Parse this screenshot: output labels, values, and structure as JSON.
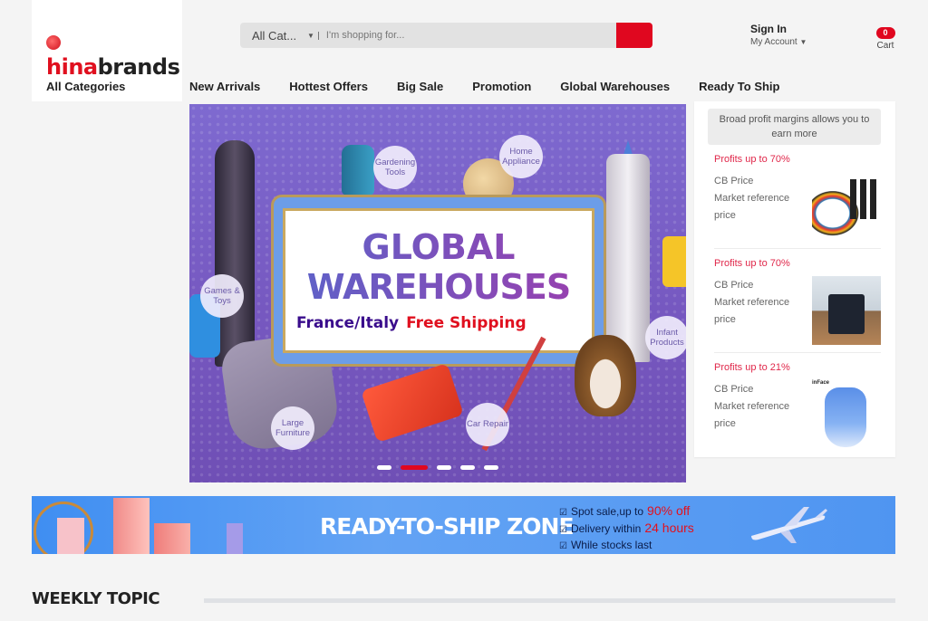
{
  "header": {
    "logo": {
      "part1": "hina",
      "part2": "brands",
      "lead": "c"
    },
    "search": {
      "category": "All Cat...",
      "placeholder": "I'm shopping for...",
      "value": ""
    },
    "account": {
      "sign_in": "Sign In",
      "my_account": "My Account"
    },
    "cart": {
      "count": "0",
      "label": "Cart"
    }
  },
  "nav": {
    "all_categories": "All Categories",
    "items": [
      "New Arrivals",
      "Hottest Offers",
      "Big Sale",
      "Promotion",
      "Global Warehouses",
      "Ready To Ship"
    ]
  },
  "hero": {
    "title_line1": "GLOBAL",
    "title_line2": "WAREHOUSES",
    "subtitle_left": "France/Italy",
    "subtitle_right": "Free Shipping",
    "bubbles": [
      "Gardening Tools",
      "Home Appliance",
      "Games & Toys",
      "Infant Products",
      "Large Furniture",
      "Car Repair"
    ],
    "slides_total": 5,
    "active_slide": 2
  },
  "profit_panel": {
    "note": "Broad profit margins allows you to earn more",
    "items": [
      {
        "profit": "Profits up to 70%",
        "cb_price": "CB Price",
        "market_ref_1": "Market reference",
        "market_ref_2": "price",
        "image": "resistance-bands"
      },
      {
        "profit": "Profits up to 70%",
        "cb_price": "CB Price",
        "market_ref_1": "Market reference",
        "market_ref_2": "price",
        "image": "uv-sterilizer"
      },
      {
        "profit": "Profits up to 21%",
        "cb_price": "CB Price",
        "market_ref_1": "Market reference",
        "market_ref_2": "price",
        "image": "inface-cleanser",
        "image_brand": "inFace"
      }
    ]
  },
  "ready_to_ship": {
    "title": "READY-TO-SHIP ZONE",
    "bullets": [
      {
        "text": "Spot sale,up to",
        "highlight": "90% off"
      },
      {
        "text": "Delivery within",
        "highlight": "24 hours"
      },
      {
        "text": "While stocks last",
        "highlight": ""
      }
    ]
  },
  "weekly_topic": {
    "title": "WEEKLY TOPIC"
  },
  "colors": {
    "brand_red": "#e0071f",
    "profit_red": "#e0274a",
    "hero_purple": "#7658c0",
    "rts_blue": "#4f95f1"
  }
}
